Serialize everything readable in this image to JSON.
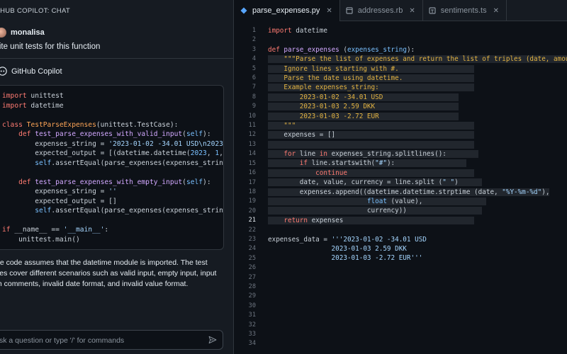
{
  "chat": {
    "header": "THUB COPILOT: CHAT",
    "user_name": "monalisa",
    "user_message": "rite unit tests for this function",
    "copilot_name": "GitHub Copilot",
    "explanation": [
      "he code assumes that the datetime module is imported. The test",
      "ses cover different scenarios such as valid input, empty input, input",
      "th comments, invalid date format, and invalid value format."
    ],
    "input_placeholder": "sk a question or type '/' for commands"
  },
  "tabs": [
    {
      "label": "parse_expenses.py",
      "active": true,
      "icon": "python-file-icon",
      "close": "✕"
    },
    {
      "label": "addresses.rb",
      "active": false,
      "icon": "ruby-file-icon",
      "close": "✕"
    },
    {
      "label": "sentiments.ts",
      "active": false,
      "icon": "typescript-file-icon",
      "close": "✕"
    }
  ],
  "editor": {
    "line_numbers": [
      "1",
      "2",
      "3",
      "4",
      "5",
      "6",
      "7",
      "8",
      "9",
      "10",
      "11",
      "12",
      "13",
      "14",
      "15",
      "16",
      "17",
      "18",
      "19",
      "20",
      "21",
      "22",
      "23",
      "24",
      "25",
      "26",
      "27",
      "28",
      "29",
      "30",
      "31",
      "32",
      "33",
      "34"
    ],
    "current_line": "21"
  },
  "colors": {
    "background": "#0d1117",
    "panel": "#161b22",
    "keyword": "#ff7b72",
    "function": "#d2a8ff",
    "string": "#a5d6ff",
    "docstring": "#e3b341"
  }
}
